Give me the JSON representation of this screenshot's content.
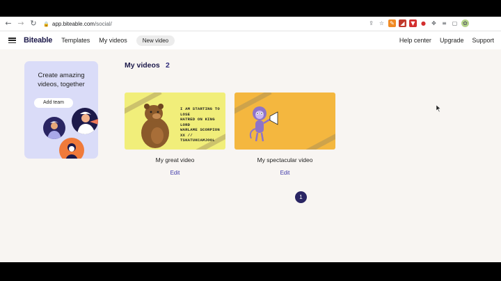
{
  "browser": {
    "url_domain": "app.biteable.com",
    "url_path": "/social/",
    "nav_icons": [
      "back-icon",
      "forward-icon",
      "reload-icon"
    ],
    "ext_icons": [
      "share-icon",
      "star-icon",
      "ext1-icon",
      "ext2-icon",
      "ext3-icon",
      "ext4-icon",
      "puzzle-icon",
      "list-icon",
      "window-icon",
      "profile-icon"
    ]
  },
  "header": {
    "brand": "Biteable",
    "templates": "Templates",
    "my_videos": "My videos",
    "new_video": "New video",
    "help": "Help center",
    "upgrade": "Upgrade",
    "support": "Support"
  },
  "promo": {
    "title_line1": "Create amazing",
    "title_line2": "videos, together",
    "button": "Add team"
  },
  "videos": {
    "title": "My videos",
    "count": "2",
    "items": [
      {
        "name": "My great video",
        "edit": "Edit",
        "caption": [
          "I AM STARTING TO LOSE",
          "HATRED ON KING LORD",
          "WARLAME SCORPION",
          "XX //",
          "TSKATUKCAMJOOL"
        ],
        "bg": "#f1ee7a"
      },
      {
        "name": "My spectacular video",
        "edit": "Edit",
        "bg": "#f4b73f"
      }
    ]
  },
  "pagination": {
    "current": "1"
  },
  "colors": {
    "brand": "#1d1a4b",
    "accent": "#2a2563",
    "edit": "#3c36a8",
    "promo_bg": "#dadcf8"
  }
}
